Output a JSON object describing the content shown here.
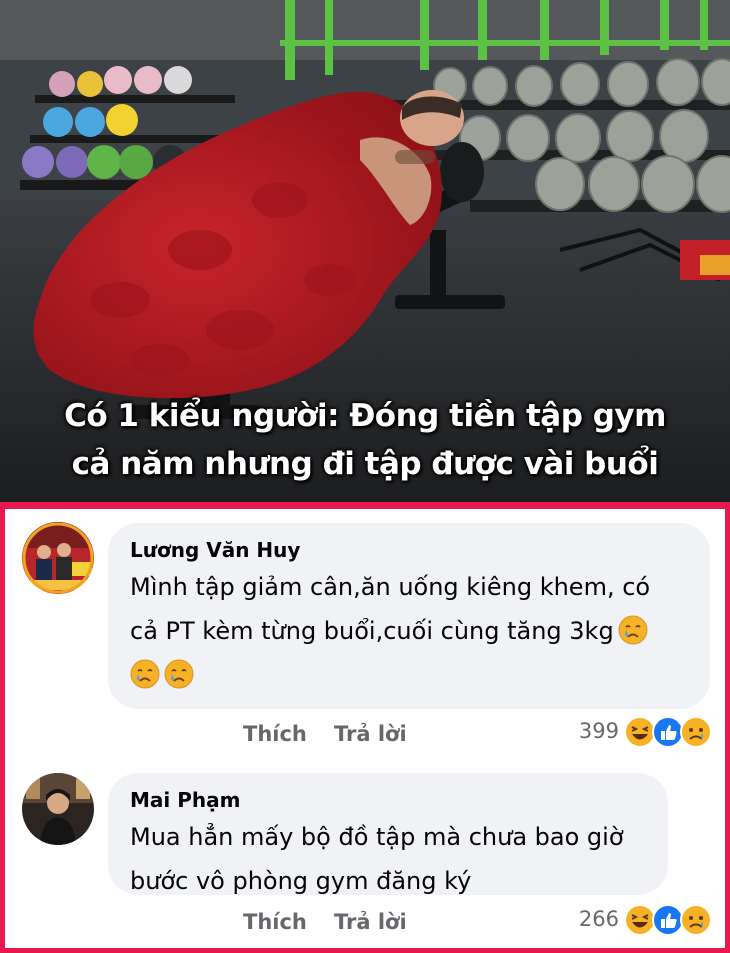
{
  "banner": {
    "caption_lines": [
      "Có 1 kiểu người: Đóng tiền tập gym",
      "cả năm nhưng đi tập được vài buổi"
    ]
  },
  "comments": [
    {
      "author": "Lương Văn Huy",
      "text_line1": "Mình tập giảm cân,ăn uống kiêng khem, có",
      "text_line2": "cả PT kèm từng buổi,cuối cùng tăng 3kg",
      "emojis": [
        "crying-face-emoji",
        "crying-face-emoji",
        "crying-face-emoji"
      ],
      "like_label": "Thích",
      "reply_label": "Trả lời",
      "reaction_count": "399",
      "reaction_icons": [
        "haha-icon",
        "like-icon",
        "sad-icon"
      ]
    },
    {
      "author": "Mai Phạm",
      "text_line1": "Mua hẳn mấy bộ đồ tập mà chưa bao giờ",
      "text_line2": "bước vô phòng gym đăng ký",
      "like_label": "Thích",
      "reply_label": "Trả lời",
      "reaction_count": "266",
      "reaction_icons": [
        "haha-icon",
        "like-icon",
        "sad-icon"
      ]
    }
  ],
  "colors": {
    "frame": "#e9184f",
    "bubble": "#f0f2f5",
    "meta_text": "#65676b",
    "like_blue": "#1877f2",
    "emoji_yellow": "#f7b125"
  }
}
